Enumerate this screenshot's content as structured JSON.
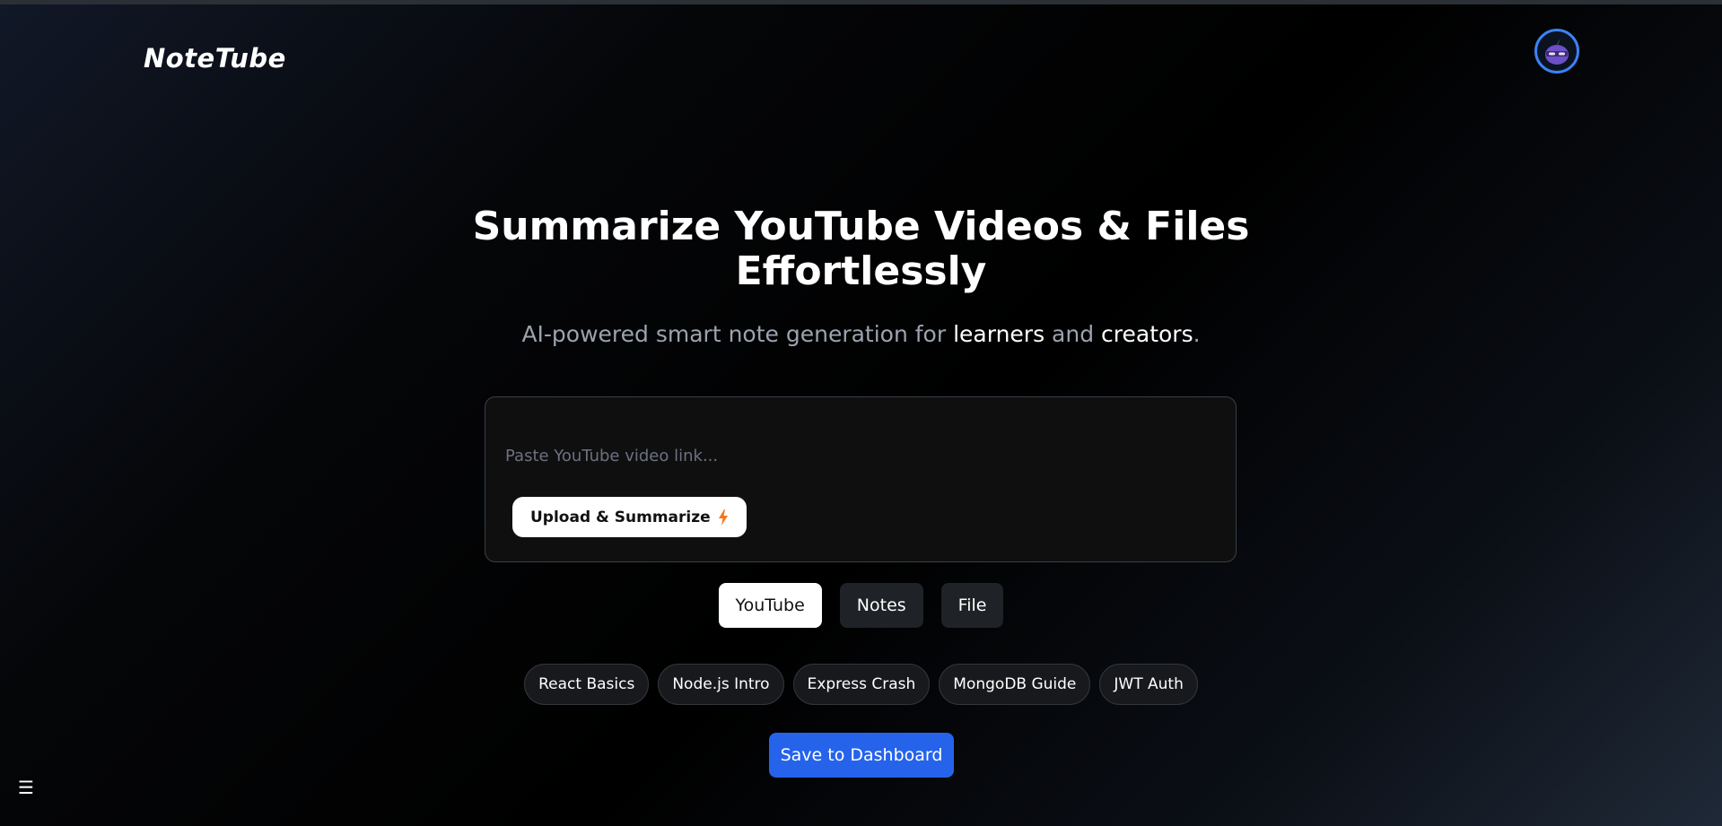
{
  "header": {
    "logo_text": "NoteTube",
    "avatar_icon": "ninja-avatar-icon"
  },
  "hero": {
    "title_line1": "Summarize YouTube Videos & Files",
    "title_line2": "Effortlessly",
    "subtitle_prefix": "AI-powered smart note generation for ",
    "subtitle_learners": "learners",
    "subtitle_and": " and ",
    "subtitle_creators": "creators",
    "subtitle_suffix": "."
  },
  "input_card": {
    "link_placeholder": "Paste YouTube video link...",
    "link_value": "",
    "upload_label": "Upload & Summarize",
    "upload_icon": "lightning-icon"
  },
  "tabs": [
    {
      "label": "YouTube",
      "active": true
    },
    {
      "label": "Notes",
      "active": false
    },
    {
      "label": "File",
      "active": false
    }
  ],
  "suggestions": [
    {
      "label": "React Basics"
    },
    {
      "label": "Node.js Intro"
    },
    {
      "label": "Express Crash"
    },
    {
      "label": "MongoDB Guide"
    },
    {
      "label": "JWT Auth"
    }
  ],
  "save_button": {
    "label": "Save to Dashboard"
  },
  "menu_toggle": {
    "icon": "hamburger-menu-icon",
    "glyph": "☰"
  },
  "colors": {
    "accent_blue": "#2563eb",
    "avatar_ring": "#3b82f6",
    "lightning": "#f97316",
    "avatar_purple": "#6d4fc8"
  }
}
